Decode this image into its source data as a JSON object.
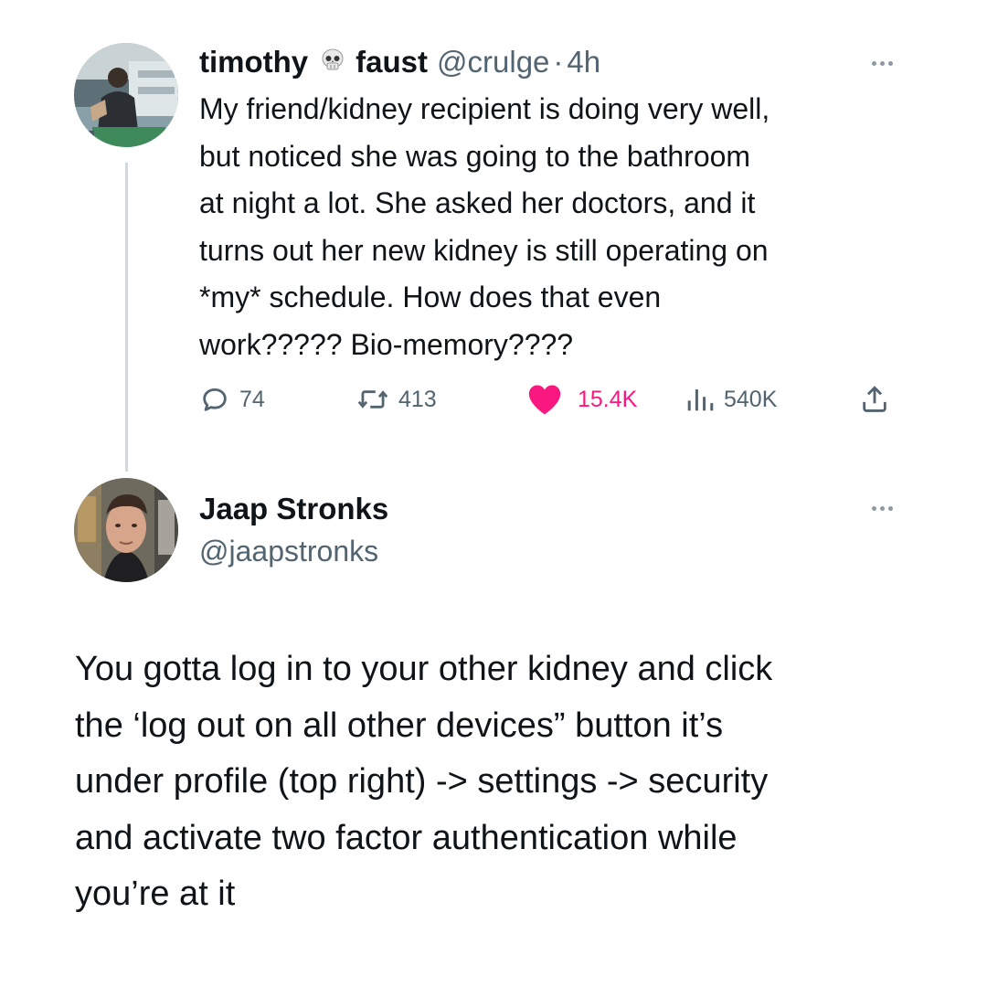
{
  "tweet1": {
    "display_name_first": "timothy",
    "display_name_emoji": "skull-icon",
    "display_name_last": "faust",
    "handle": "@crulge",
    "separator": "·",
    "time": "4h",
    "text_lines": [
      "My friend/kidney recipient is doing very well,",
      "but noticed she was going to the bathroom",
      "at night a lot. She asked her doctors, and it",
      "turns out her new kidney is still operating on",
      "*my* schedule. How does that even",
      "work????? Bio-memory????"
    ],
    "replies": "74",
    "reposts": "413",
    "likes": "15.4K",
    "views": "540K",
    "colors": {
      "like": "#f91880",
      "meta": "#536471",
      "thread_line": "#cfd9de"
    }
  },
  "tweet2": {
    "display_name": "Jaap Stronks",
    "handle": "@jaapstronks",
    "text_lines": [
      "You gotta log in to your other kidney and click",
      "the ‘log out on all other devices” button it’s",
      "under profile (top right) -> settings -> security",
      "and activate two factor authentication while",
      "you’re at it"
    ]
  }
}
